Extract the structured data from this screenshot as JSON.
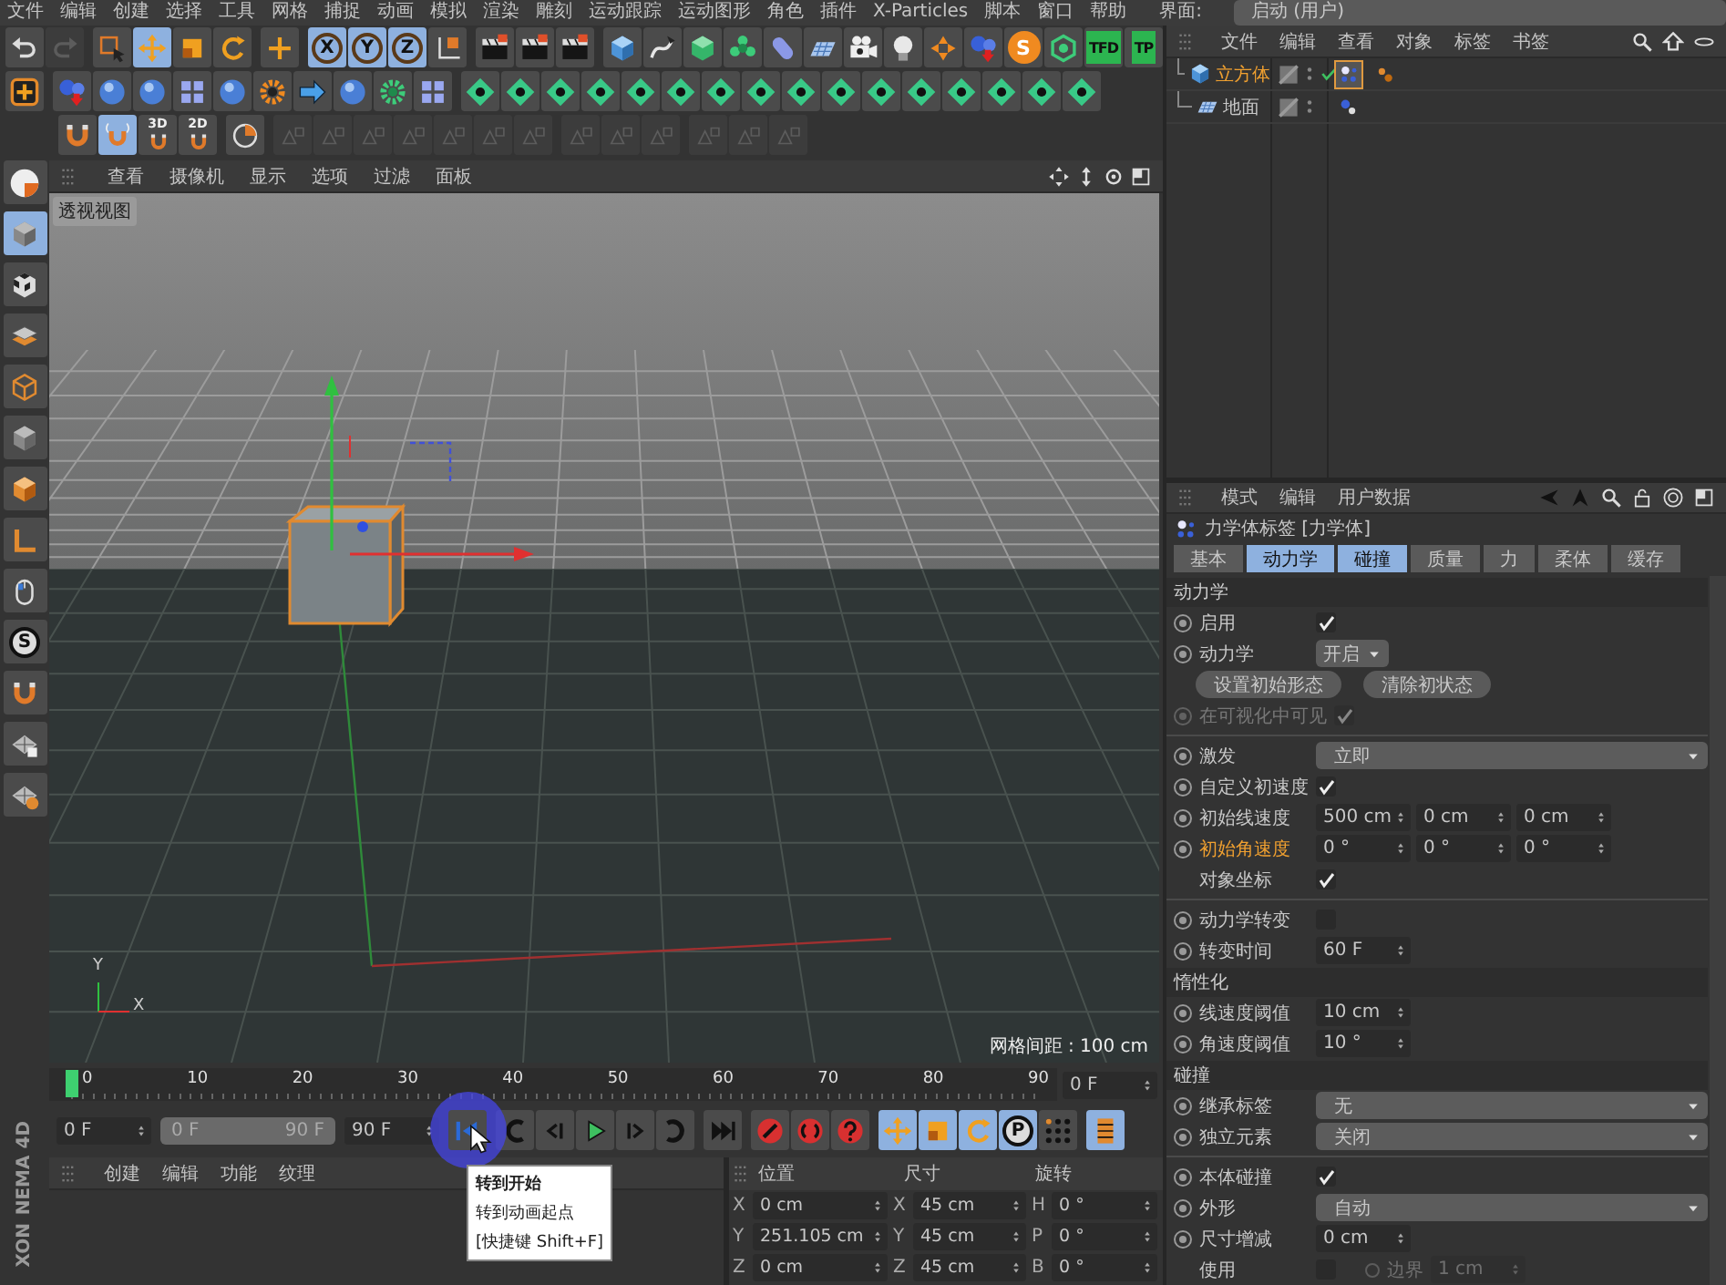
{
  "menu_bar": {
    "items": [
      "文件",
      "编辑",
      "创建",
      "选择",
      "工具",
      "网格",
      "捕捉",
      "动画",
      "模拟",
      "渲染",
      "雕刻",
      "运动跟踪",
      "运动图形",
      "角色",
      "插件",
      "X-Particles",
      "脚本",
      "窗口",
      "帮助"
    ],
    "layout_label": "界面:",
    "layout_value": "启动 (用户)"
  },
  "toolbars": [
    {
      "groups": [
        [
          {
            "kind": "undo",
            "selected": false,
            "disabled": false
          },
          {
            "kind": "redo",
            "selected": false,
            "disabled": true
          }
        ],
        [
          {
            "kind": "select",
            "selected": false,
            "disabled": false
          },
          {
            "kind": "move",
            "selected": true,
            "disabled": false
          },
          {
            "kind": "scale",
            "selected": false,
            "disabled": false
          },
          {
            "kind": "rotate",
            "selected": false,
            "disabled": false
          }
        ],
        [
          {
            "kind": "add",
            "selected": false,
            "disabled": false
          }
        ],
        [
          {
            "kind": "axis-letter",
            "text": "X",
            "selected": true,
            "disabled": false
          },
          {
            "kind": "axis-letter",
            "text": "Y",
            "selected": true,
            "disabled": false
          },
          {
            "kind": "axis-letter",
            "text": "Z",
            "selected": true,
            "disabled": false
          },
          {
            "kind": "axes",
            "selected": false,
            "disabled": false
          }
        ],
        [
          {
            "kind": "film",
            "selected": false,
            "disabled": false
          },
          {
            "kind": "film",
            "selected": false,
            "disabled": false
          },
          {
            "kind": "film",
            "selected": false,
            "disabled": false
          }
        ],
        [
          {
            "kind": "cube",
            "selected": false,
            "disabled": false
          },
          {
            "kind": "pen",
            "selected": false,
            "disabled": false
          },
          {
            "kind": "subdiv",
            "selected": false,
            "disabled": false
          },
          {
            "kind": "flower",
            "selected": false,
            "disabled": false
          },
          {
            "kind": "capsule",
            "selected": false,
            "disabled": false
          },
          {
            "kind": "plane",
            "selected": false,
            "disabled": false
          },
          {
            "kind": "camera",
            "selected": false,
            "disabled": false
          },
          {
            "kind": "bulb",
            "selected": false,
            "disabled": false
          },
          {
            "kind": "arrows",
            "selected": false,
            "disabled": false
          },
          {
            "kind": "spheres",
            "selected": false,
            "disabled": false
          },
          {
            "kind": "badge-letter",
            "text": "S",
            "selected": false,
            "disabled": false
          },
          {
            "kind": "molecule",
            "selected": false,
            "disabled": false
          },
          {
            "kind": "box-letter",
            "text": "TFD",
            "selected": false,
            "disabled": false
          },
          {
            "kind": "box-letter",
            "text": "TP",
            "selected": false,
            "disabled": false
          }
        ]
      ]
    },
    {
      "groups": [
        [
          {
            "kind": "target",
            "selected": false,
            "disabled": false
          }
        ],
        [
          {
            "kind": "spheres",
            "selected": false,
            "disabled": false
          },
          {
            "kind": "sphere",
            "selected": false,
            "disabled": false
          },
          {
            "kind": "sphere",
            "selected": false,
            "disabled": false
          },
          {
            "kind": "blocks",
            "selected": false,
            "disabled": false
          },
          {
            "kind": "sphere",
            "selected": false,
            "disabled": false
          },
          {
            "kind": "gear",
            "selected": false,
            "disabled": false
          },
          {
            "kind": "arrow",
            "selected": false,
            "disabled": false
          },
          {
            "kind": "sphere",
            "selected": false,
            "disabled": false
          },
          {
            "kind": "sprocket",
            "selected": false,
            "disabled": false
          },
          {
            "kind": "blocks",
            "selected": false,
            "disabled": false
          }
        ],
        [
          {
            "kind": "diamond",
            "selected": false,
            "disabled": false
          },
          {
            "kind": "diamond",
            "selected": false,
            "disabled": false
          },
          {
            "kind": "diamond",
            "selected": false,
            "disabled": false
          },
          {
            "kind": "diamond",
            "selected": false,
            "disabled": false
          },
          {
            "kind": "diamond",
            "selected": false,
            "disabled": false
          },
          {
            "kind": "diamond",
            "selected": false,
            "disabled": false
          },
          {
            "kind": "diamond",
            "selected": false,
            "disabled": false
          },
          {
            "kind": "diamond",
            "selected": false,
            "disabled": false
          },
          {
            "kind": "diamond",
            "selected": false,
            "disabled": false
          },
          {
            "kind": "diamond",
            "selected": false,
            "disabled": false
          },
          {
            "kind": "diamond",
            "selected": false,
            "disabled": false
          },
          {
            "kind": "diamond",
            "selected": false,
            "disabled": false
          },
          {
            "kind": "diamond",
            "selected": false,
            "disabled": false
          },
          {
            "kind": "diamond",
            "selected": false,
            "disabled": false
          },
          {
            "kind": "diamond",
            "selected": false,
            "disabled": false
          },
          {
            "kind": "diamond",
            "selected": false,
            "disabled": false
          }
        ]
      ]
    },
    {
      "groups": [
        [
          {
            "kind": "magnet",
            "selected": false,
            "disabled": false
          },
          {
            "kind": "magnetwave",
            "selected": true,
            "disabled": false
          },
          {
            "kind": "magnet-letter",
            "text": "3D",
            "selected": false,
            "disabled": false
          },
          {
            "kind": "magnet-letter",
            "text": "2D",
            "selected": false,
            "disabled": false
          }
        ],
        [
          {
            "kind": "pie",
            "selected": false,
            "disabled": false
          }
        ],
        [
          {
            "kind": "faded",
            "selected": false,
            "disabled": true
          },
          {
            "kind": "faded",
            "selected": false,
            "disabled": true
          },
          {
            "kind": "faded",
            "selected": false,
            "disabled": true
          },
          {
            "kind": "faded",
            "selected": false,
            "disabled": true
          },
          {
            "kind": "faded",
            "selected": false,
            "disabled": true
          },
          {
            "kind": "faded",
            "selected": false,
            "disabled": true
          },
          {
            "kind": "faded",
            "selected": false,
            "disabled": true
          }
        ],
        [
          {
            "kind": "faded",
            "selected": false,
            "disabled": true
          },
          {
            "kind": "faded",
            "selected": false,
            "disabled": true
          },
          {
            "kind": "faded",
            "selected": false,
            "disabled": true
          }
        ],
        [
          {
            "kind": "faded",
            "selected": false,
            "disabled": true
          },
          {
            "kind": "faded",
            "selected": false,
            "disabled": true
          },
          {
            "kind": "faded",
            "selected": false,
            "disabled": true
          }
        ]
      ]
    }
  ],
  "side_toolbar": {
    "items": [
      {
        "kind": "logo",
        "selected": false
      },
      {
        "kind": "solidcube",
        "selected": true
      },
      {
        "kind": "checker",
        "selected": false
      },
      {
        "kind": "layers",
        "selected": false
      },
      {
        "kind": "outlinecube",
        "selected": false
      },
      {
        "kind": "solidcube",
        "selected": false
      },
      {
        "kind": "orangecube",
        "selected": false
      },
      {
        "kind": "angle",
        "selected": false
      },
      {
        "kind": "mouse",
        "selected": false
      },
      {
        "kind": "circle-letter",
        "text": "S",
        "selected": false
      },
      {
        "kind": "magnet",
        "selected": false
      },
      {
        "kind": "gridlock",
        "selected": false
      },
      {
        "kind": "grid",
        "selected": false
      }
    ]
  },
  "viewport": {
    "menu": [
      "查看",
      "摄像机",
      "显示",
      "选项",
      "过滤",
      "面板"
    ],
    "view_name": "透视视图",
    "grid_spacing": "网格间距 : 100 cm",
    "axis_labels": [
      "Y",
      "X"
    ]
  },
  "timeline": {
    "ticks": [
      "0",
      "10",
      "20",
      "30",
      "40",
      "50",
      "60",
      "70",
      "80",
      "90"
    ],
    "current_frame": "0 F",
    "start_field": "0 F",
    "range": {
      "start": "0 F",
      "end": "90 F",
      "level": 1
    },
    "end_field": "90 F",
    "controls": [
      [
        {
          "kind": "gotostart",
          "selected": false
        }
      ],
      [
        {
          "kind": "prevkey",
          "selected": false
        },
        {
          "kind": "prevframe",
          "selected": false
        },
        {
          "kind": "play",
          "selected": false
        },
        {
          "kind": "nextframe",
          "selected": false
        },
        {
          "kind": "nextkey",
          "selected": false
        }
      ],
      [
        {
          "kind": "gotoend",
          "selected": false
        }
      ],
      [
        {
          "kind": "record",
          "selected": false
        },
        {
          "kind": "autokey",
          "selected": false
        },
        {
          "kind": "help",
          "selected": false
        }
      ],
      [
        {
          "kind": "move",
          "selected": true
        },
        {
          "kind": "scale",
          "selected": true
        },
        {
          "kind": "rotate",
          "selected": true
        },
        {
          "kind": "circle-letter",
          "text": "P",
          "selected": true
        },
        {
          "kind": "points",
          "selected": false
        }
      ],
      [
        {
          "kind": "timeline",
          "selected": true
        }
      ]
    ]
  },
  "tooltip": {
    "lines": [
      "转到开始",
      "转到动画起点",
      "[快捷键 Shift+F]"
    ]
  },
  "logo": [
    "XON",
    "NEMA 4D"
  ],
  "material_manager": {
    "menu": [
      "创建",
      "编辑",
      "功能",
      "纹理"
    ]
  },
  "coordinates": {
    "headers": [
      "位置",
      "尺寸",
      "旋转"
    ],
    "rows": [
      {
        "cells": [
          {
            "axis": "X",
            "value": "0 cm"
          },
          {
            "axis": "X",
            "value": "45 cm"
          },
          {
            "axis": "H",
            "value": "0 °"
          }
        ]
      },
      {
        "cells": [
          {
            "axis": "Y",
            "value": "251.105 cm"
          },
          {
            "axis": "Y",
            "value": "45 cm"
          },
          {
            "axis": "P",
            "value": "0 °"
          }
        ]
      },
      {
        "cells": [
          {
            "axis": "Z",
            "value": "0 cm"
          },
          {
            "axis": "Z",
            "value": "45 cm"
          },
          {
            "axis": "B",
            "value": "0 °"
          }
        ]
      }
    ]
  },
  "object_manager": {
    "menu": [
      "文件",
      "编辑",
      "查看",
      "对象",
      "标签",
      "书签"
    ],
    "objects": [
      {
        "name": "立方体",
        "kind": "cube",
        "selected": true,
        "checked": true,
        "tags": [
          {
            "kind": "tagdyn",
            "selected": true
          },
          {
            "kind": "tagballs",
            "selected": false
          }
        ]
      },
      {
        "name": "地面",
        "kind": "plane",
        "selected": false,
        "checked": false,
        "tags": [
          {
            "kind": "tagcollider",
            "selected": false
          }
        ]
      }
    ]
  },
  "attributes": {
    "menu": [
      "模式",
      "编辑",
      "用户数据"
    ],
    "title": "力学体标签 [力学体]",
    "tabs": [
      {
        "label": "基本",
        "selected": false
      },
      {
        "label": "动力学",
        "selected": true
      },
      {
        "label": "碰撞",
        "selected": true
      },
      {
        "label": "质量",
        "selected": false
      },
      {
        "label": "力",
        "selected": false
      },
      {
        "label": "柔体",
        "selected": false
      },
      {
        "label": "缓存",
        "selected": false
      }
    ],
    "rows": [
      {
        "kind": "header",
        "label": "动力学"
      },
      {
        "kind": "check",
        "label": "启用",
        "keyframe": true,
        "disabled": false,
        "highlight": false,
        "checked": true
      },
      {
        "kind": "mini-dropdown",
        "label": "动力学",
        "keyframe": true,
        "disabled": false,
        "highlight": false,
        "value": "开启"
      },
      {
        "kind": "buttons",
        "buttons": [
          "设置初始形态",
          "清除初状态"
        ]
      },
      {
        "kind": "check",
        "label": "在可视化中可见",
        "keyframe": true,
        "disabled": true,
        "highlight": false,
        "checked": true
      },
      {
        "kind": "divider"
      },
      {
        "kind": "dropdown",
        "label": "激发",
        "keyframe": true,
        "disabled": false,
        "highlight": false,
        "value": "立即"
      },
      {
        "kind": "check",
        "label": "自定义初速度",
        "keyframe": true,
        "disabled": false,
        "highlight": false,
        "checked": true
      },
      {
        "kind": "vector",
        "label": "初始线速度",
        "keyframe": true,
        "disabled": false,
        "highlight": false,
        "values": [
          "500 cm",
          "0 cm",
          "0 cm"
        ]
      },
      {
        "kind": "vector",
        "label": "初始角速度",
        "keyframe": true,
        "disabled": false,
        "highlight": true,
        "values": [
          "0 °",
          "0 °",
          "0 °"
        ]
      },
      {
        "kind": "check",
        "label": "对象坐标",
        "keyframe": false,
        "disabled": false,
        "highlight": false,
        "checked": true
      },
      {
        "kind": "divider"
      },
      {
        "kind": "check",
        "label": "动力学转变",
        "keyframe": true,
        "disabled": false,
        "highlight": false,
        "checked": false
      },
      {
        "kind": "field",
        "label": "转变时间",
        "keyframe": true,
        "disabled": false,
        "highlight": false,
        "value": "60 F"
      },
      {
        "kind": "header",
        "label": "惰性化"
      },
      {
        "kind": "field",
        "label": "线速度阈值",
        "keyframe": true,
        "disabled": false,
        "highlight": false,
        "value": "10 cm"
      },
      {
        "kind": "field",
        "label": "角速度阈值",
        "keyframe": true,
        "disabled": false,
        "highlight": false,
        "value": "10 °"
      },
      {
        "kind": "header",
        "label": "碰撞"
      },
      {
        "kind": "dropdown",
        "label": "继承标签",
        "keyframe": true,
        "disabled": false,
        "highlight": false,
        "value": "无"
      },
      {
        "kind": "dropdown",
        "label": "独立元素",
        "keyframe": true,
        "disabled": false,
        "highlight": false,
        "value": "关闭"
      },
      {
        "kind": "divider"
      },
      {
        "kind": "check",
        "label": "本体碰撞",
        "keyframe": true,
        "disabled": false,
        "highlight": false,
        "checked": true
      },
      {
        "kind": "dropdown",
        "label": "外形",
        "keyframe": true,
        "disabled": false,
        "highlight": false,
        "value": "自动"
      },
      {
        "kind": "field",
        "label": "尺寸增减",
        "keyframe": true,
        "disabled": false,
        "highlight": false,
        "value": "0 cm"
      },
      {
        "kind": "check-field",
        "label": "使用",
        "keyframe": false,
        "disabled": false,
        "highlight": false,
        "checked": false,
        "sub_label": "边界",
        "sub_value": "1 cm",
        "sub_disabled": true
      }
    ]
  }
}
